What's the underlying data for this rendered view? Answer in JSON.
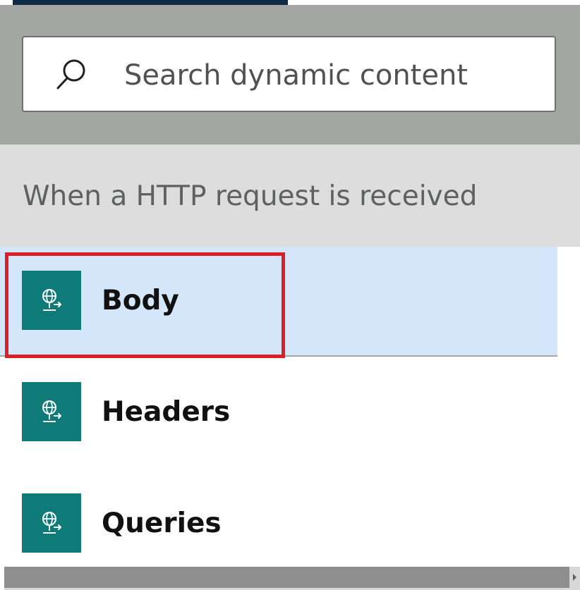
{
  "search": {
    "placeholder": "Search dynamic content",
    "value": ""
  },
  "icons": {
    "search": "search-icon",
    "item": "http-globe-icon"
  },
  "group": {
    "title": "When a HTTP request is received"
  },
  "items": [
    {
      "label": "Body",
      "selected": true,
      "highlighted": true
    },
    {
      "label": "Headers",
      "selected": false,
      "highlighted": false
    },
    {
      "label": "Queries",
      "selected": false,
      "highlighted": false
    }
  ],
  "colors": {
    "top_tab": "#0f2b45",
    "search_panel": "#a3a6a2",
    "group_header": "#dcdddc",
    "selected_row": "#d3e6fa",
    "icon_tile": "#0f7b78",
    "highlight": "#da1f26",
    "scrollbar_thumb": "#8e8e8e"
  }
}
